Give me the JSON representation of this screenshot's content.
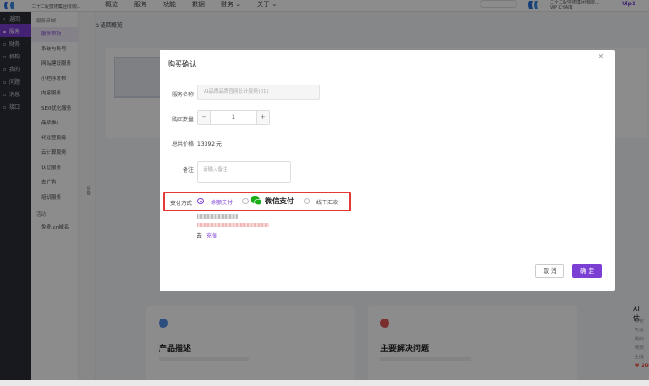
{
  "topbar": {
    "company": "二十二紀技術集团有限...",
    "nav": [
      "概览",
      "服务",
      "功能",
      "数据",
      "财务 ⌄",
      "关于 ⌄"
    ],
    "account_line1": "二十二紀技術集团有限...",
    "account_line2": "VIP CHAIN",
    "vip": "Vip1"
  },
  "sidebar": {
    "items": [
      {
        "label": "返回",
        "active": false
      },
      {
        "label": "服务",
        "active": true
      },
      {
        "label": "财务",
        "active": false
      },
      {
        "label": "机构",
        "active": false
      },
      {
        "label": "我的",
        "active": false
      },
      {
        "label": "问题",
        "active": false
      },
      {
        "label": "消息",
        "active": false
      },
      {
        "label": "接口",
        "active": false
      }
    ]
  },
  "submenu": {
    "group1": "服务商城",
    "items": [
      "服务市场",
      "系统与账号",
      "网站建设服务",
      "小程序发布",
      "内容服务",
      "SEO优化服务",
      "品牌推广",
      "代运营服务",
      "云计算服务",
      "认证服务",
      "去广告",
      "培训服务"
    ],
    "group2": "活动",
    "items2": [
      "免费.cn域名"
    ],
    "collapse": "折叠"
  },
  "main": {
    "back": "返回概览",
    "cards": [
      {
        "title": "产品描述"
      },
      {
        "title": "主要解决问题"
      }
    ],
    "right_peek_title": "AI 估",
    "right_peek_lines": [
      "适合",
      "可以",
      "贸的",
      "网页",
      "生成"
    ],
    "right_peek_price": "¥ 20"
  },
  "modal": {
    "title": "购买确认",
    "close": "×",
    "service_label": "服务名称",
    "service_value": "AI品牌品牌官网设计服务(01)",
    "qty_label": "购买数量",
    "qty_minus": "−",
    "qty_value": "1",
    "qty_plus": "+",
    "total_label": "总共价格",
    "total_value": "13392 元",
    "note_label": "备注",
    "note_placeholder": "请输入备注",
    "pay_label": "支付方式",
    "pay_options": [
      {
        "label": "余额支付",
        "selected": true
      },
      {
        "label": "微信支付",
        "selected": false
      },
      {
        "label": "线下汇款",
        "selected": false
      }
    ],
    "go": "去",
    "recharge": "充值",
    "cancel": "取 消",
    "confirm": "确 定"
  },
  "colors": {
    "accent": "#7b3fd4",
    "sidebar_bg": "#2b2f3a",
    "highlight_border": "#e53935",
    "wechat_green": "#1aad19"
  }
}
